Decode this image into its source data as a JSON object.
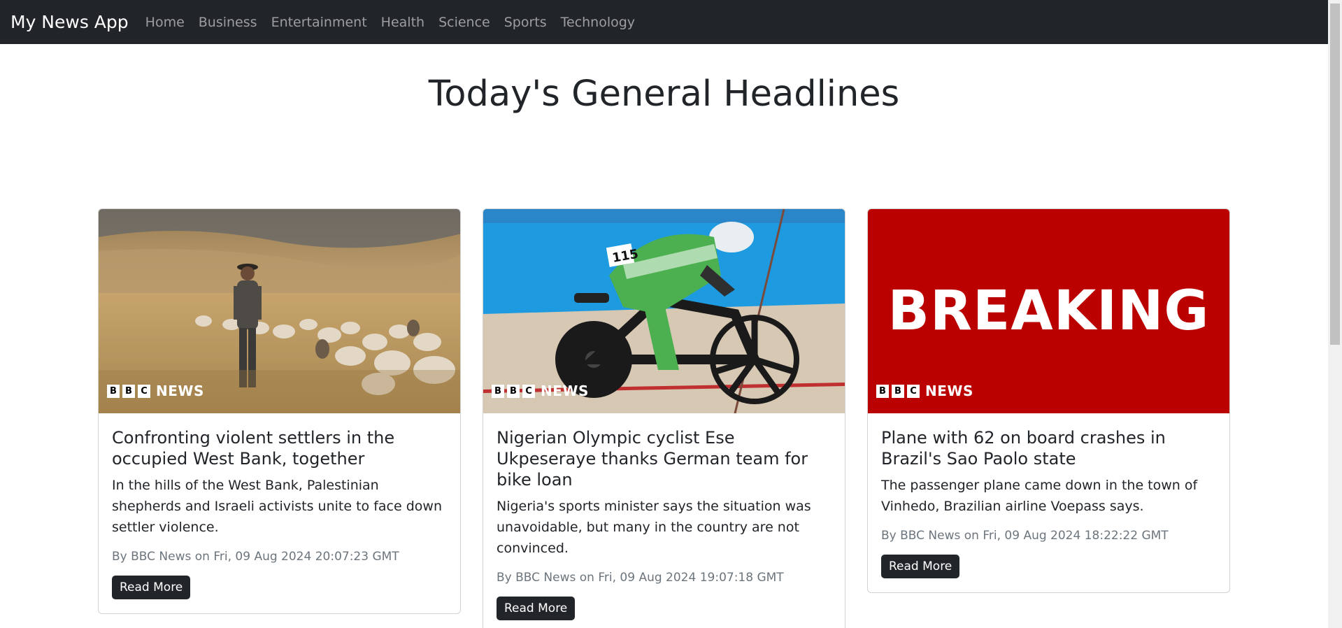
{
  "navbar": {
    "brand": "My News App",
    "links": [
      "Home",
      "Business",
      "Entertainment",
      "Health",
      "Science",
      "Sports",
      "Technology"
    ]
  },
  "page": {
    "title": "Today's General Headlines"
  },
  "bbc_logo": {
    "letters": [
      "B",
      "B",
      "C"
    ],
    "news": "NEWS"
  },
  "articles": [
    {
      "title": "Confronting violent settlers in the occupied West Bank, together",
      "description": "In the hills of the West Bank, Palestinian shepherds and Israeli activists unite to face down settler violence.",
      "meta": "By BBC News on Fri, 09 Aug 2024 20:07:23 GMT",
      "button": "Read More"
    },
    {
      "title": "Nigerian Olympic cyclist Ese Ukpeseraye thanks German team for bike loan",
      "description": "Nigeria's sports minister says the situation was unavoidable, but many in the country are not convinced.",
      "meta": "By BBC News on Fri, 09 Aug 2024 19:07:18 GMT",
      "button": "Read More"
    },
    {
      "title": "Plane with 62 on board crashes in Brazil's Sao Paolo state",
      "description": "The passenger plane came down in the town of Vinhedo, Brazilian airline Voepass says.",
      "meta": "By BBC News on Fri, 09 Aug 2024 18:22:22 GMT",
      "button": "Read More"
    }
  ],
  "breaking_text": "BREAKING",
  "cyclist_bib": "115",
  "colors": {
    "navbar": "#212529",
    "breaking_red": "#bb0000",
    "button": "#212529"
  }
}
